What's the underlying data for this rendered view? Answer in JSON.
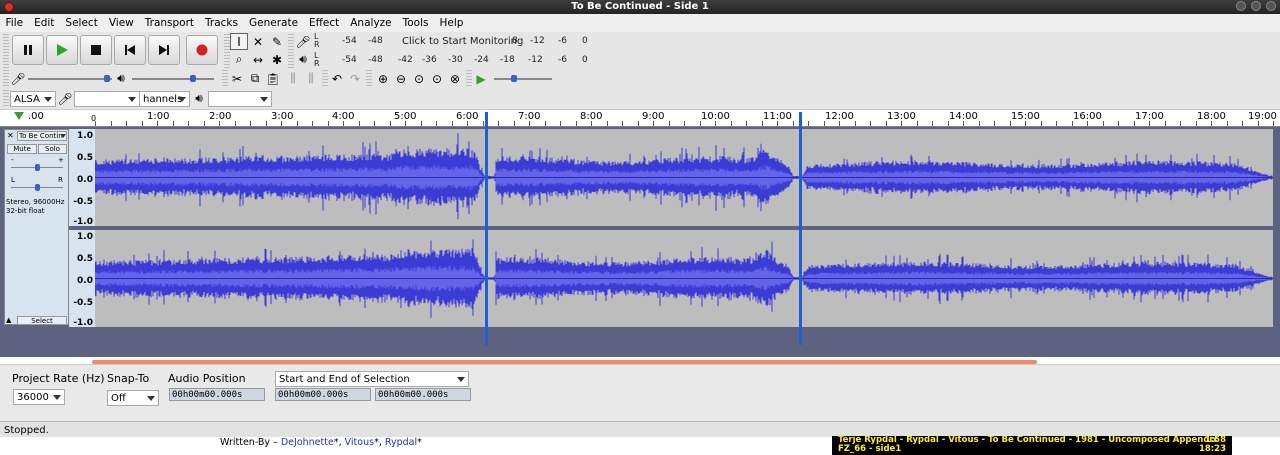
{
  "window": {
    "title": "To Be Continued - Side 1"
  },
  "menu": [
    "File",
    "Edit",
    "Select",
    "View",
    "Transport",
    "Tracks",
    "Generate",
    "Effect",
    "Analyze",
    "Tools",
    "Help"
  ],
  "meters": {
    "record_prompt": "Click to Start Monitoring",
    "record_ticks": [
      "-54",
      "-48",
      "8",
      "-12",
      "-6",
      "0"
    ],
    "play_ticks": [
      "-54",
      "-48",
      "-42",
      "-36",
      "-30",
      "-24",
      "-18",
      "-12",
      "-6",
      "0"
    ],
    "lr": [
      "L",
      "R"
    ]
  },
  "device": {
    "host": "ALSA",
    "channels": "hannels"
  },
  "ruler": {
    "labels": [
      ".00",
      "1:00",
      "2:00",
      "3:00",
      "4:00",
      "5:00",
      "6:00",
      "7:00",
      "8:00",
      "9:00",
      "10:00",
      "11:00",
      "12:00",
      "13:00",
      "14:00",
      "15:00",
      "16:00",
      "17:00",
      "18:00",
      "19:00"
    ],
    "zero": "0"
  },
  "track": {
    "name": "To Be Contin",
    "mute": "Mute",
    "solo": "Solo",
    "gain_minus": "-",
    "gain_plus": "+",
    "pan_l": "L",
    "pan_r": "R",
    "info1": "Stereo, 96000Hz",
    "info2": "32-bit float",
    "select": "Select",
    "scale": [
      "1.0",
      "0.5",
      "0.0",
      "-0.5",
      "-1.0"
    ]
  },
  "selection_toolbar": {
    "project_rate_label": "Project Rate (Hz)",
    "project_rate": "36000",
    "snap_to_label": "Snap-To",
    "snap_to": "Off",
    "audio_position_label": "Audio Position",
    "selection_mode": "Start and End of Selection",
    "audio_position": "00h00m00.000s",
    "sel_start": "00h00m00.000s",
    "sel_end": "00h00m00.000s"
  },
  "status": "Stopped.",
  "credits": {
    "prefix": "Written-By – ",
    "n1": "DeJohnette",
    "n2": "Vitous",
    "n3": "Rypdal",
    "star": "*",
    "sep": ", "
  },
  "now_playing": {
    "line1": "Terje Rypdal - Rypdal - Vitous - To Be Continued - 1981 - Uncomposed Appendix",
    "line2": "FZ_66 - side1",
    "time1": "1:58",
    "time2": "18:23"
  },
  "colors": {
    "waveform": "#3b3bd6",
    "cursor": "#1e5fd6",
    "track_bg": "#bdbdbd"
  }
}
